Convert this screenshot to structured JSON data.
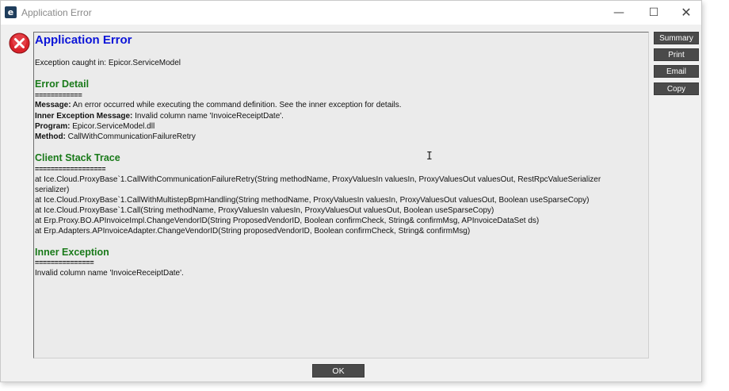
{
  "window": {
    "title": "Application Error",
    "app_icon_letter": "e",
    "minimize_glyph": "—",
    "maximize_glyph": "☐",
    "close_glyph": "✕"
  },
  "error": {
    "heading": "Application Error",
    "exception_line": "Exception caught in: Epicor.ServiceModel",
    "detail_heading": "Error Detail",
    "detail_separator": "============",
    "message_label": "Message:",
    "message_value": " An error occurred while executing the command definition. See the inner exception for details.",
    "inner_msg_label": "Inner Exception Message:",
    "inner_msg_value": " Invalid column name 'InvoiceReceiptDate'.",
    "program_label": "Program:",
    "program_value": " Epicor.ServiceModel.dll",
    "method_label": "Method:",
    "method_value": " CallWithCommunicationFailureRetry",
    "stack_heading": "Client Stack Trace",
    "stack_separator": "==================",
    "stack_lines": [
      "   at Ice.Cloud.ProxyBase`1.CallWithCommunicationFailureRetry(String methodName, ProxyValuesIn valuesIn, ProxyValuesOut valuesOut, RestRpcValueSerializer",
      "serializer)",
      "   at Ice.Cloud.ProxyBase`1.CallWithMultistepBpmHandling(String methodName, ProxyValuesIn valuesIn, ProxyValuesOut valuesOut, Boolean useSparseCopy)",
      "   at Ice.Cloud.ProxyBase`1.Call(String methodName, ProxyValuesIn valuesIn, ProxyValuesOut valuesOut, Boolean useSparseCopy)",
      "   at Erp.Proxy.BO.APInvoiceImpl.ChangeVendorID(String ProposedVendorID, Boolean confirmCheck, String& confirmMsg, APInvoiceDataSet ds)",
      "   at Erp.Adapters.APInvoiceAdapter.ChangeVendorID(String proposedVendorID, Boolean confirmCheck, String& confirmMsg)"
    ],
    "inner_heading": "Inner Exception",
    "inner_separator": "===============",
    "inner_value": "Invalid column name 'InvoiceReceiptDate'."
  },
  "buttons": {
    "summary": "Summary",
    "print": "Print",
    "email": "Email",
    "copy": "Copy",
    "ok": "OK"
  },
  "colors": {
    "heading_blue": "#0b14d8",
    "section_green": "#1a7a1a",
    "button_dark": "#4a4a4a",
    "error_red": "#d9222a"
  },
  "cursor_glyph": "I"
}
